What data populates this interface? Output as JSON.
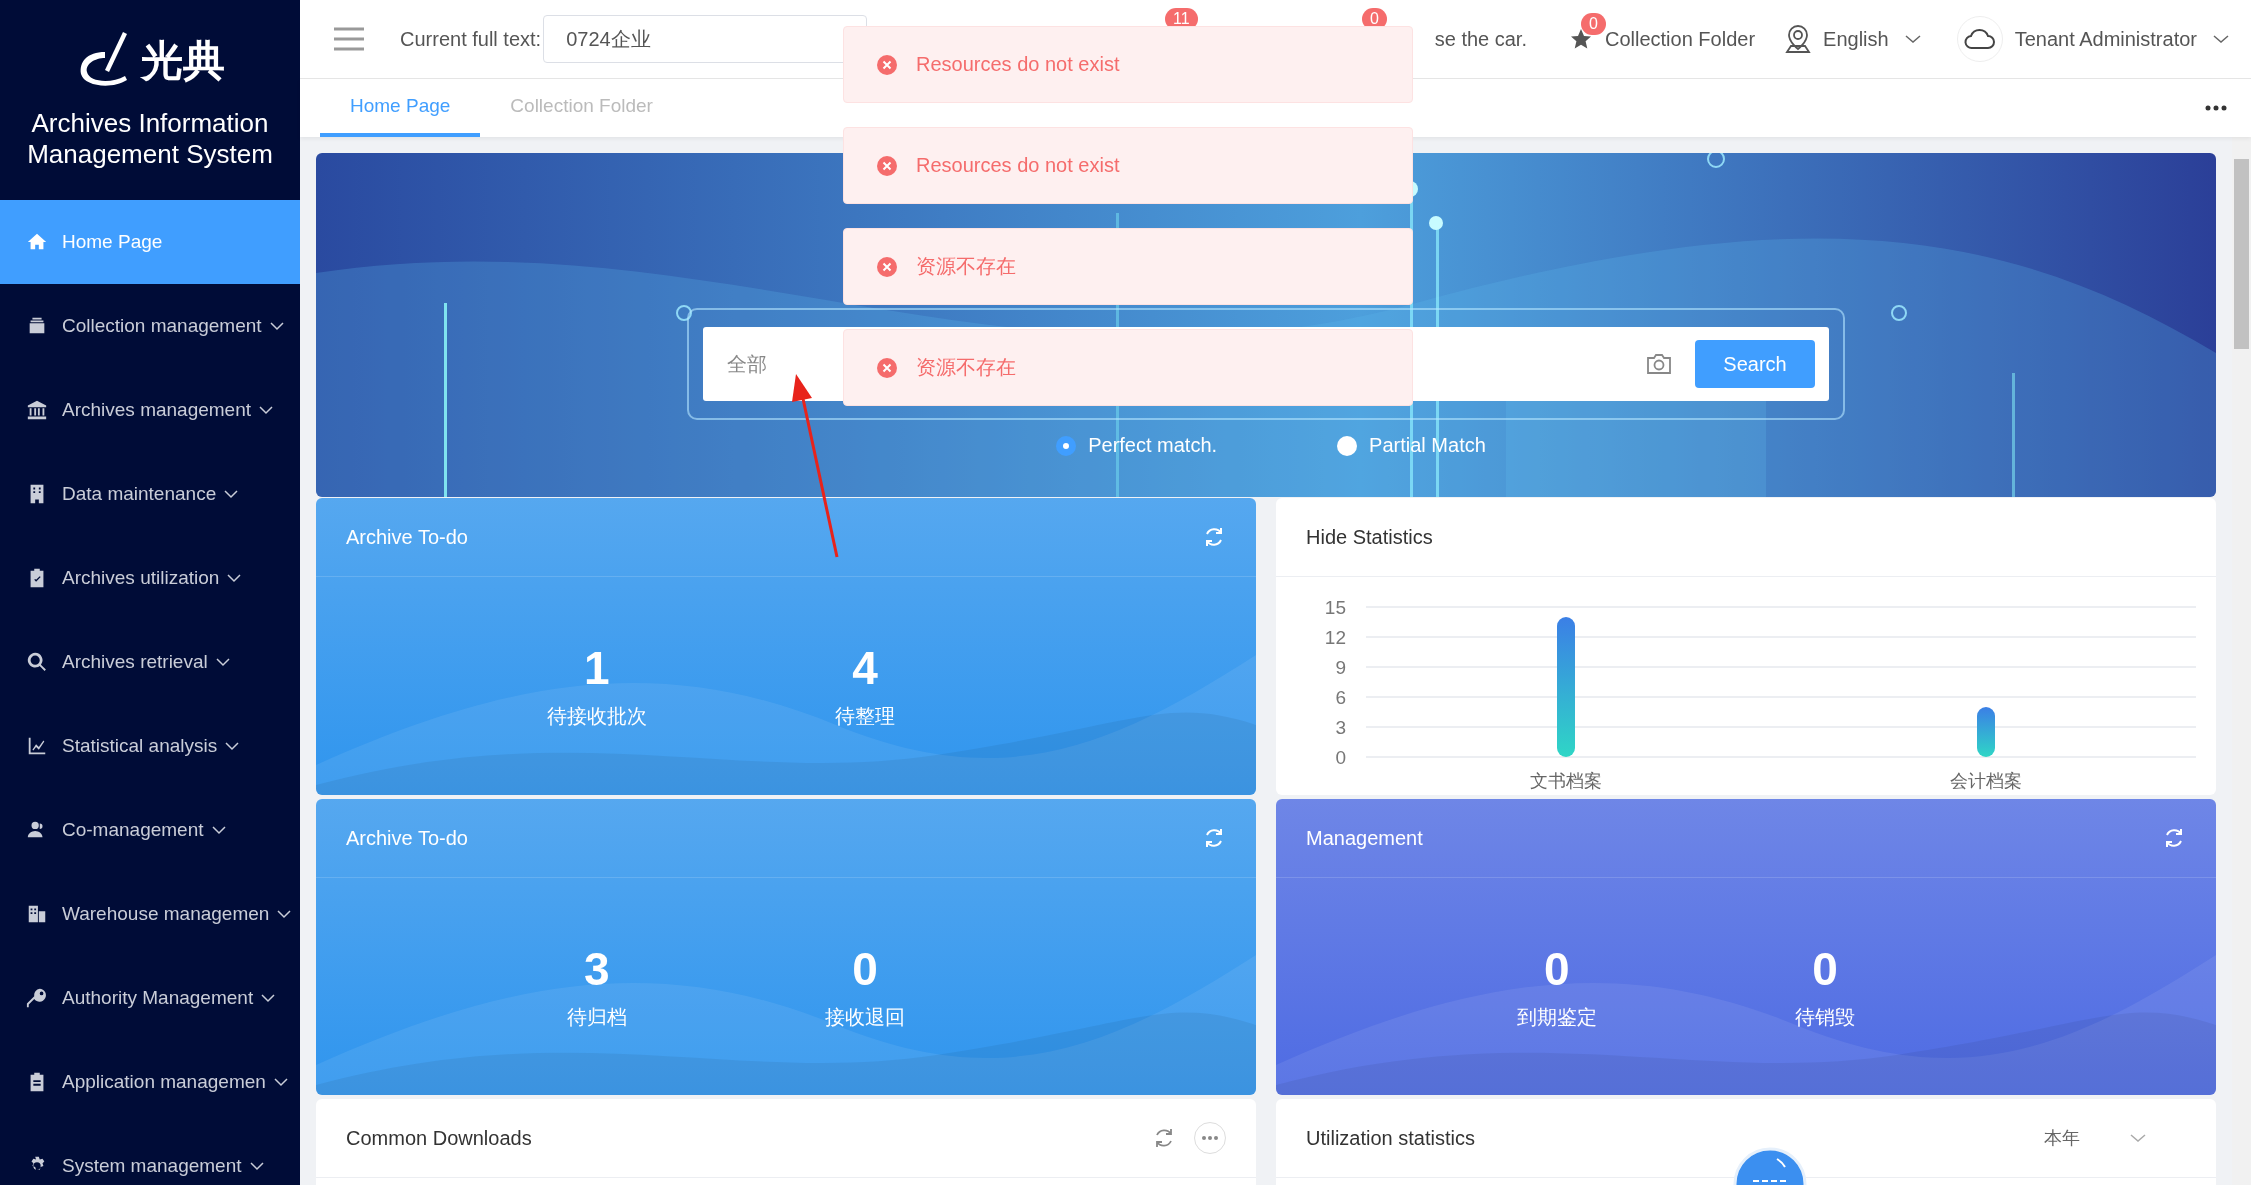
{
  "sidebar": {
    "logo_text": "光典",
    "title": "Archives Information Management System",
    "items": [
      {
        "label": "Home Page",
        "selected": true,
        "expandable": false
      },
      {
        "label": "Collection management",
        "selected": false,
        "expandable": true
      },
      {
        "label": "Archives management",
        "selected": false,
        "expandable": true
      },
      {
        "label": "Data maintenance",
        "selected": false,
        "expandable": true
      },
      {
        "label": "Archives utilization",
        "selected": false,
        "expandable": true
      },
      {
        "label": "Archives retrieval",
        "selected": false,
        "expandable": true
      },
      {
        "label": "Statistical analysis",
        "selected": false,
        "expandable": true
      },
      {
        "label": "Co-management",
        "selected": false,
        "expandable": true
      },
      {
        "label": "Warehouse managemen",
        "selected": false,
        "expandable": true
      },
      {
        "label": "Authority Management",
        "selected": false,
        "expandable": true
      },
      {
        "label": "Application managemen",
        "selected": false,
        "expandable": true
      },
      {
        "label": "System management",
        "selected": false,
        "expandable": true
      }
    ]
  },
  "header": {
    "full_text_label": "Current full text:",
    "full_text_value": "0724企业",
    "badges": [
      "11",
      "0"
    ],
    "cut_text": "se the car.",
    "collection": {
      "label": "Collection Folder",
      "badge": "0"
    },
    "language": "English",
    "user": "Tenant Administrator"
  },
  "tabs": [
    {
      "label": "Home Page",
      "selected": true
    },
    {
      "label": "Collection Folder",
      "selected": false
    }
  ],
  "banner": {
    "scope": "全部",
    "button": "Search",
    "match_options": [
      {
        "label": "Perfect match.",
        "selected": true
      },
      {
        "label": "Partial Match",
        "selected": false
      }
    ]
  },
  "cards": [
    {
      "kind": "stats",
      "color": "#2f95ee",
      "title": "Archive To-do",
      "stats": [
        {
          "value": "1",
          "label": "待接收批次"
        },
        {
          "value": "4",
          "label": "待整理"
        }
      ]
    },
    {
      "kind": "chart",
      "title": "Hide Statistics",
      "chart_data": {
        "type": "bar",
        "categories": [
          "文书档案",
          "会计档案"
        ],
        "values": [
          14,
          5
        ],
        "grid": true,
        "ylim": [
          0,
          15
        ],
        "yticks": [
          0,
          3,
          6,
          9,
          12,
          15
        ]
      }
    },
    {
      "kind": "stats",
      "color": "#2f95ee",
      "title": "Archive To-do",
      "stats": [
        {
          "value": "3",
          "label": "待归档"
        },
        {
          "value": "0",
          "label": "接收退回"
        }
      ]
    },
    {
      "kind": "stats",
      "color": "#4e6be3",
      "title": "Management",
      "stats": [
        {
          "value": "0",
          "label": "到期鉴定"
        },
        {
          "value": "0",
          "label": "待销毁"
        }
      ]
    },
    {
      "kind": "downloads",
      "title": "Common Downloads"
    },
    {
      "kind": "usage",
      "title": "Utilization statistics",
      "period": "本年"
    }
  ],
  "toasts": [
    {
      "message": "Resources do not exist"
    },
    {
      "message": "Resources do not exist"
    },
    {
      "message": "资源不存在"
    },
    {
      "message": "资源不存在"
    }
  ]
}
